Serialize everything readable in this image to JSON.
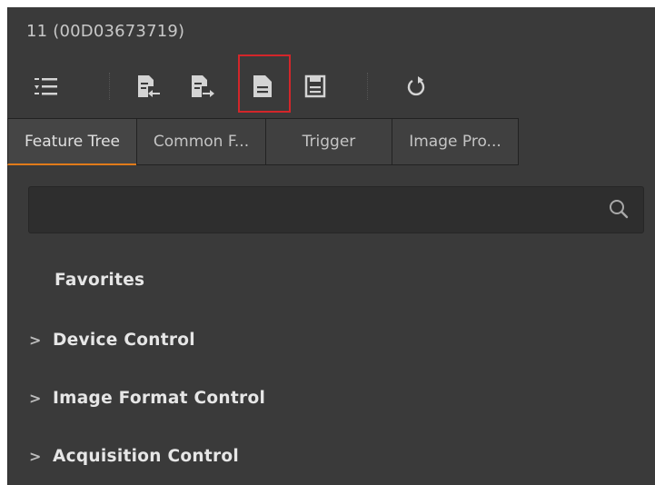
{
  "header": {
    "title": "11 (00D03673719)"
  },
  "toolbar": {
    "buttons": [
      {
        "name": "tree-view-toggle",
        "icon": "list-tree-icon"
      },
      {
        "name": "import-features",
        "icon": "file-import-icon"
      },
      {
        "name": "export-features",
        "icon": "file-export-icon"
      },
      {
        "name": "load-parameters",
        "icon": "document-icon"
      },
      {
        "name": "save-parameters",
        "icon": "save-icon"
      },
      {
        "name": "refresh",
        "icon": "refresh-icon"
      }
    ],
    "highlight_color": "#d3262a"
  },
  "tabs": [
    {
      "label": "Feature Tree",
      "active": true
    },
    {
      "label": "Common F..."
    },
    {
      "label": "Trigger"
    },
    {
      "label": "Image Pro..."
    }
  ],
  "search": {
    "value": "",
    "placeholder": "",
    "icon": "search-icon"
  },
  "tree": {
    "favorites": "Favorites",
    "items": [
      {
        "label": "Device Control",
        "expander": "chevron-right-icon"
      },
      {
        "label": "Image Format Control",
        "expander": "chevron-right-icon"
      },
      {
        "label": "Acquisition Control",
        "expander": "chevron-right-icon"
      }
    ]
  },
  "colors": {
    "background": "#3a3a3a",
    "accent": "#e07b1a",
    "text": "#e6e6e6"
  }
}
